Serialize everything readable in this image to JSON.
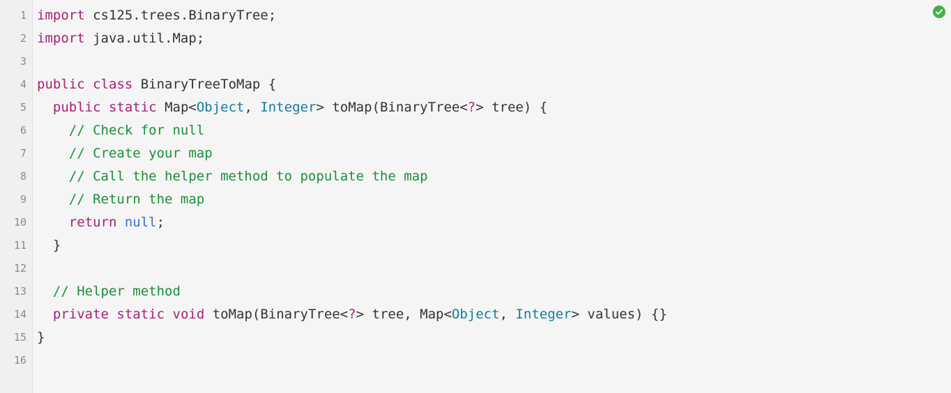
{
  "status": {
    "icon": "check-circle",
    "color": "#3eb24a"
  },
  "editor": {
    "gutter": [
      "1",
      "2",
      "3",
      "4",
      "5",
      "6",
      "7",
      "8",
      "9",
      "10",
      "11",
      "12",
      "13",
      "14",
      "15",
      "16"
    ],
    "lines": [
      {
        "t": [
          [
            "kw",
            "import"
          ],
          [
            "pln",
            " cs125.trees.BinaryTree;"
          ]
        ]
      },
      {
        "t": [
          [
            "kw",
            "import"
          ],
          [
            "pln",
            " java.util.Map;"
          ]
        ]
      },
      {
        "t": []
      },
      {
        "t": [
          [
            "kw",
            "public"
          ],
          [
            "pln",
            " "
          ],
          [
            "kw",
            "class"
          ],
          [
            "pln",
            " BinaryTreeToMap {"
          ]
        ]
      },
      {
        "indent": 1,
        "t": [
          [
            "kw",
            "public"
          ],
          [
            "pln",
            " "
          ],
          [
            "kw",
            "static"
          ],
          [
            "pln",
            " Map<"
          ],
          [
            "type",
            "Object"
          ],
          [
            "pln",
            ", "
          ],
          [
            "type",
            "Integer"
          ],
          [
            "pln",
            "> toMap(BinaryTree<"
          ],
          [
            "kw",
            "?"
          ],
          [
            "pln",
            "> tree) {"
          ]
        ]
      },
      {
        "indent": 2,
        "t": [
          [
            "cmt",
            "// Check for null"
          ]
        ]
      },
      {
        "indent": 2,
        "t": [
          [
            "cmt",
            "// Create your map"
          ]
        ]
      },
      {
        "indent": 2,
        "t": [
          [
            "cmt",
            "// Call the helper method to populate the map"
          ]
        ]
      },
      {
        "indent": 2,
        "t": [
          [
            "cmt",
            "// Return the map"
          ]
        ]
      },
      {
        "indent": 2,
        "t": [
          [
            "kw",
            "return"
          ],
          [
            "pln",
            " "
          ],
          [
            "nul",
            "null"
          ],
          [
            "pln",
            ";"
          ]
        ]
      },
      {
        "indent": 1,
        "t": [
          [
            "pln",
            "}"
          ]
        ]
      },
      {
        "t": []
      },
      {
        "indent": 1,
        "t": [
          [
            "cmt",
            "// Helper method"
          ]
        ]
      },
      {
        "indent": 1,
        "t": [
          [
            "kw",
            "private"
          ],
          [
            "pln",
            " "
          ],
          [
            "kw",
            "static"
          ],
          [
            "pln",
            " "
          ],
          [
            "kw",
            "void"
          ],
          [
            "pln",
            " toMap(BinaryTree<"
          ],
          [
            "kw",
            "?"
          ],
          [
            "pln",
            "> tree, Map<"
          ],
          [
            "type",
            "Object"
          ],
          [
            "pln",
            ", "
          ],
          [
            "type",
            "Integer"
          ],
          [
            "pln",
            "> values) {}"
          ]
        ]
      },
      {
        "t": [
          [
            "pln",
            "}"
          ]
        ]
      },
      {
        "t": []
      }
    ]
  }
}
